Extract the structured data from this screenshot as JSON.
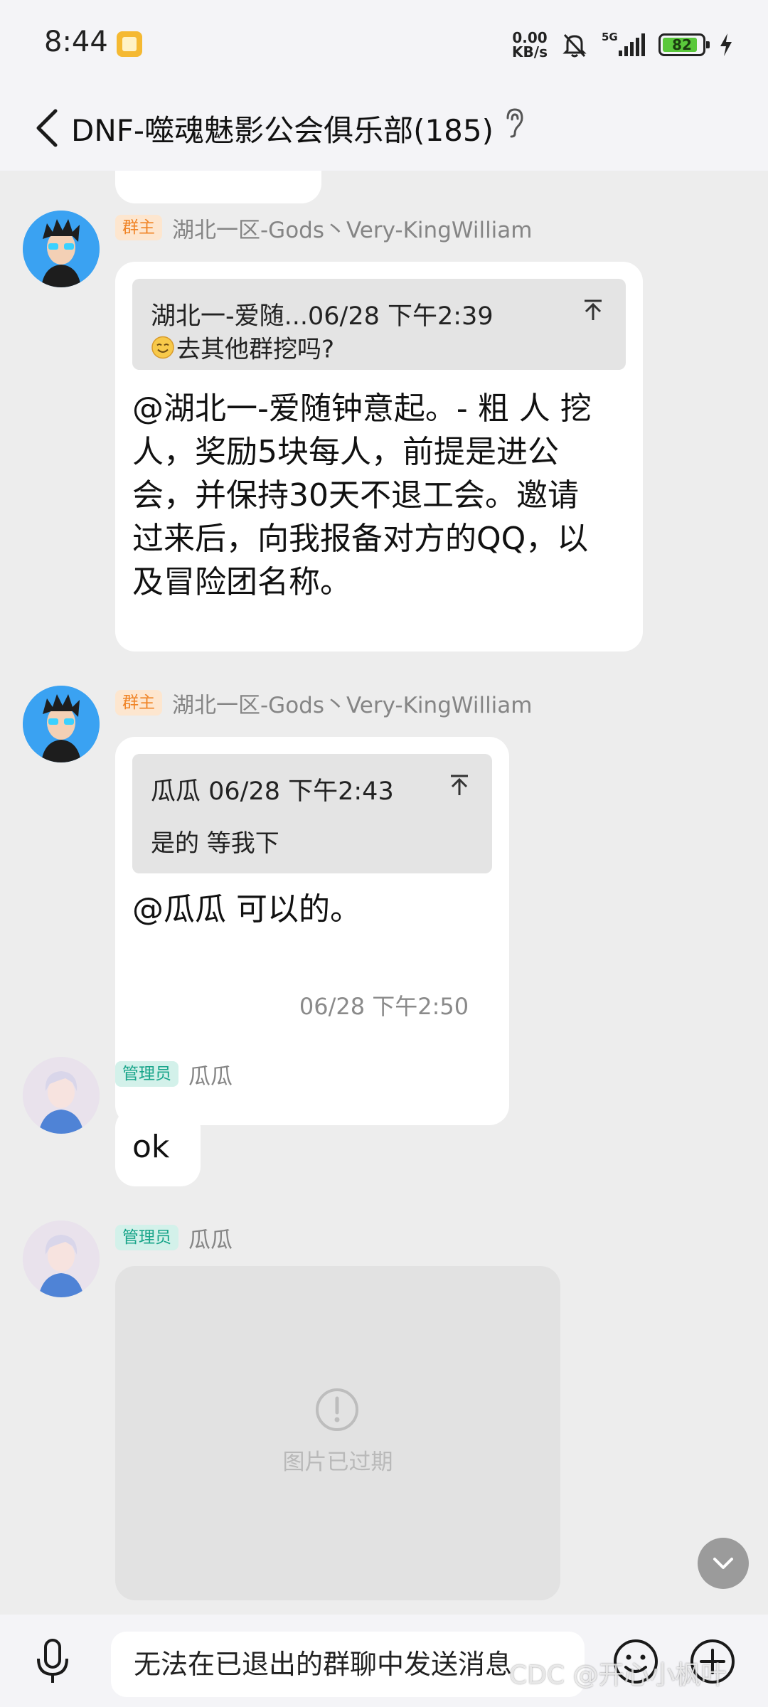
{
  "status_bar": {
    "time": "8:44",
    "net_speed_value": "0.00",
    "net_speed_unit": "KB/s",
    "network": "5G",
    "battery": "82"
  },
  "header": {
    "title": "DNF-噬魂魅影公会俱乐部(185)"
  },
  "messages": [
    {
      "role_badge": "群主",
      "sender": "湖北一区-Gods丶Very-KingWilliam",
      "quote_header": "湖北一-爱随...06/28 下午2:39",
      "quote_body": "去其他群挖吗?",
      "text_lines": [
        "@湖北一-爱随钟意起。- 粗 人 挖",
        "人，奖励5块每人，前提是进公",
        "会，并保持30天不退工会。邀请",
        "过来后，向我报备对方的QQ，以",
        "及冒险团名称。"
      ]
    },
    {
      "role_badge": "群主",
      "sender": "湖北一区-Gods丶Very-KingWilliam",
      "quote_header": "瓜瓜 06/28 下午2:43",
      "quote_body": "是的 等我下",
      "text": "@瓜瓜 可以的。"
    },
    {
      "timestamp": "06/28 下午2:50"
    },
    {
      "role_badge": "管理员",
      "sender": "瓜瓜",
      "text": "ok"
    },
    {
      "role_badge": "管理员",
      "sender": "瓜瓜",
      "image_status": "图片已过期"
    }
  ],
  "input_bar": {
    "placeholder": "无法在已退出的群聊中发送消息"
  },
  "watermark": "CDC @开心小枫叶",
  "colors": {
    "owner_badge": "#f08426",
    "admin_badge": "#19a58a",
    "avatar_blue": "#3aa2f2"
  }
}
